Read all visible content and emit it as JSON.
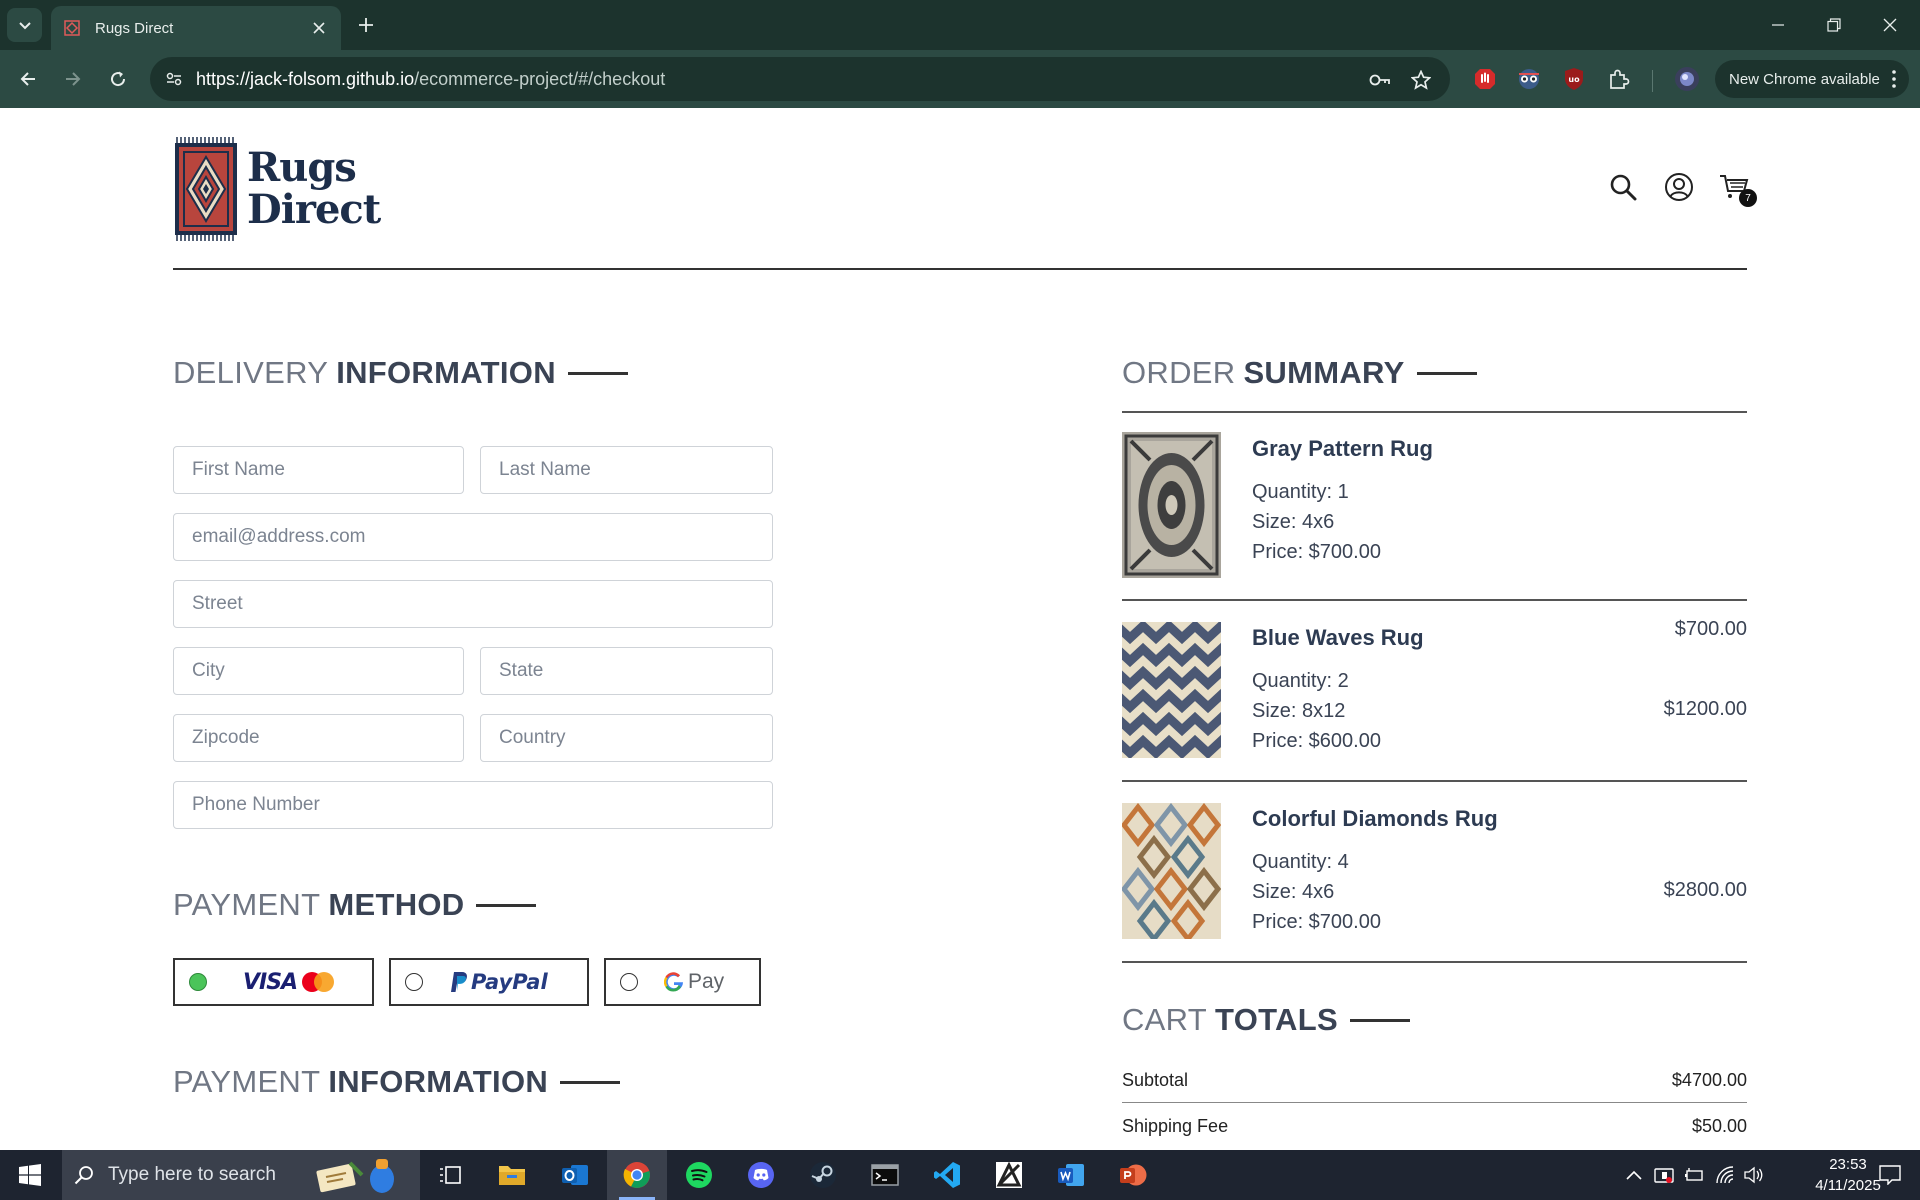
{
  "browser": {
    "tab_title": "Rugs Direct",
    "url_host": "https://jack-folsom.github.io",
    "url_path": "/ecommerce-project/#/checkout",
    "update_pill": "New Chrome available",
    "accent": "#2c4a43"
  },
  "site": {
    "logo_line1": "Rugs",
    "logo_line2": "Direct",
    "cart_count": "7"
  },
  "delivery": {
    "title_light": "DELIVERY",
    "title_bold": "INFORMATION",
    "first_name": "First Name",
    "last_name": "Last Name",
    "email": "email@address.com",
    "street": "Street",
    "city": "City",
    "state": "State",
    "zipcode": "Zipcode",
    "country": "Country",
    "phone": "Phone Number"
  },
  "payment_method": {
    "title_light": "PAYMENT",
    "title_bold": "METHOD",
    "options": [
      {
        "label": "VISA",
        "selected": true
      },
      {
        "label": "PayPal",
        "selected": false
      },
      {
        "label": "Pay",
        "selected": false
      }
    ]
  },
  "payment_info": {
    "title_light": "PAYMENT",
    "title_bold": "INFORMATION"
  },
  "order_summary": {
    "title_light": "ORDER",
    "title_bold": "SUMMARY",
    "items": [
      {
        "name": "Gray Pattern Rug",
        "quantity": "Quantity: 1",
        "size": "Size: 4x6",
        "price": "Price: $700.00",
        "total": "$700.00"
      },
      {
        "name": "Blue Waves Rug",
        "quantity": "Quantity: 2",
        "size": "Size: 8x12",
        "price": "Price: $600.00",
        "total": "$1200.00"
      },
      {
        "name": "Colorful Diamonds Rug",
        "quantity": "Quantity: 4",
        "size": "Size: 4x6",
        "price": "Price: $700.00",
        "total": "$2800.00"
      }
    ]
  },
  "cart_totals": {
    "title_light": "CART",
    "title_bold": "TOTALS",
    "subtotal_label": "Subtotal",
    "subtotal_value": "$4700.00",
    "shipping_label": "Shipping Fee",
    "shipping_value": "$50.00"
  },
  "taskbar": {
    "search_placeholder": "Type here to search",
    "time": "23:53",
    "date": "4/11/2025"
  }
}
